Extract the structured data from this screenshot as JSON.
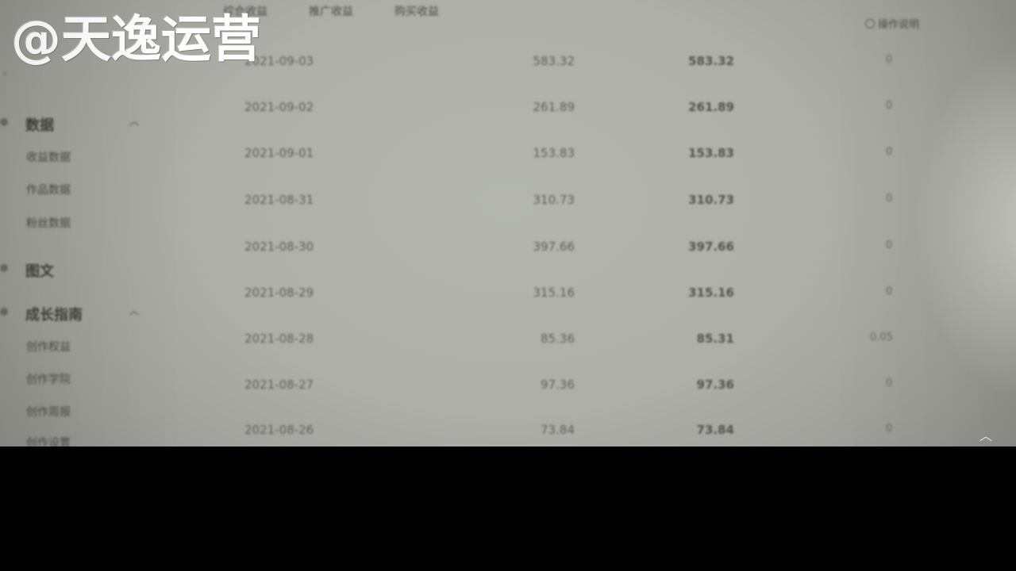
{
  "watermark": {
    "text": "@天逸运营"
  },
  "tabs": [
    {
      "label": "综合收益"
    },
    {
      "label": "推广收益"
    },
    {
      "label": "购买收益"
    }
  ],
  "right_column_header": {
    "label": "操作说明"
  },
  "sidebar": {
    "top_partial": "◦",
    "groups": [
      {
        "label": "数据",
        "items": [
          {
            "label": "收益数据"
          },
          {
            "label": "作品数据"
          },
          {
            "label": "粉丝数据"
          }
        ]
      },
      {
        "label": "图文"
      },
      {
        "label": "成长指南",
        "items": [
          {
            "label": "创作权益"
          },
          {
            "label": "创作学院"
          },
          {
            "label": "创作周报"
          },
          {
            "label": "创作设置"
          }
        ]
      }
    ]
  },
  "table": {
    "rows": [
      {
        "date": "2021-09-03",
        "pay": "583.32",
        "total": "583.32",
        "action": "0"
      },
      {
        "date": "2021-09-02",
        "pay": "261.89",
        "total": "261.89",
        "action": "0"
      },
      {
        "date": "2021-09-01",
        "pay": "153.83",
        "total": "153.83",
        "action": "0"
      },
      {
        "date": "2021-08-31",
        "pay": "310.73",
        "total": "310.73",
        "action": "0"
      },
      {
        "date": "2021-08-30",
        "pay": "397.66",
        "total": "397.66",
        "action": "0"
      },
      {
        "date": "2021-08-29",
        "pay": "315.16",
        "total": "315.16",
        "action": "0"
      },
      {
        "date": "2021-08-28",
        "pay": "85.36",
        "total": "85.31",
        "action": "0.05"
      },
      {
        "date": "2021-08-27",
        "pay": "97.36",
        "total": "97.36",
        "action": "0"
      },
      {
        "date": "2021-08-26",
        "pay": "73.84",
        "total": "73.84",
        "action": "0"
      }
    ]
  },
  "scroll_to_top": {
    "icon": "chevron-up-icon",
    "glyph": "︿"
  },
  "colors": {
    "background": "#b0b2ab",
    "text": "#5e5f5a",
    "black_bar": "#000000"
  }
}
